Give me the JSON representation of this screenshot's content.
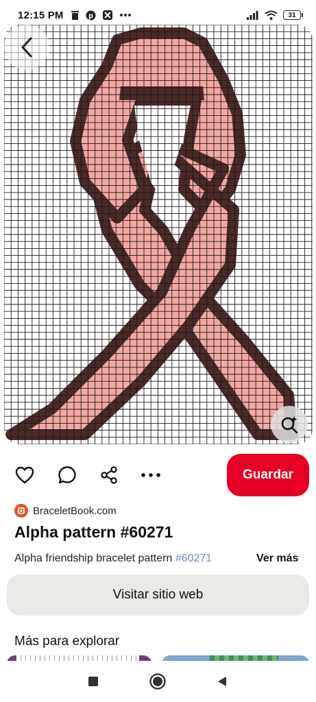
{
  "status_bar": {
    "time": "12:15 PM",
    "battery": "31",
    "icons_left": [
      "trash-icon",
      "pinterest-icon",
      "app-icon",
      "more-dots-icon"
    ],
    "icons_right": [
      "signal-icon",
      "wifi-icon",
      "battery-icon"
    ]
  },
  "pin": {
    "image": "pink ribbon alpha pattern grid",
    "colors": {
      "ribbon_fill": "#f4a7a3",
      "ribbon_outline": "#4a2a28",
      "grid_line": "#1a1a1a",
      "background": "#ffffff"
    }
  },
  "actions": {
    "like_icon": "heart-icon",
    "comment_icon": "comment-icon",
    "share_icon": "share-icon",
    "more_icon": "more-icon",
    "save_label": "Guardar"
  },
  "source": {
    "name": "BraceletBook.com"
  },
  "title": "Alpha pattern #60271",
  "description": {
    "text": "Alpha friendship bracelet pattern ",
    "tag": "#60271",
    "see_more": "Ver más"
  },
  "visit_button": "Visitar sitio web",
  "explore": {
    "title": "Más para explorar"
  },
  "colors": {
    "accent": "#e60023",
    "secondary_button": "#e9e9e6"
  }
}
